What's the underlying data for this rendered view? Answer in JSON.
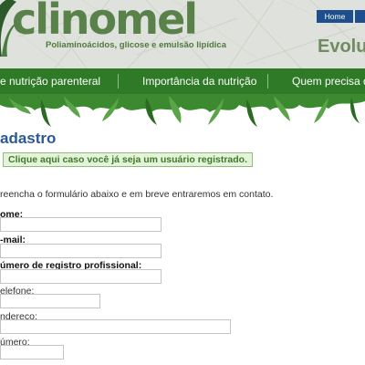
{
  "header": {
    "logo_text": "clinomel",
    "tagline": "Poliaminoácidos, glicose e emulsão lipídica",
    "slogan": "Evoluçã",
    "links": [
      "Home",
      ""
    ]
  },
  "nav": {
    "items": [
      "e nutrição parenteral",
      "Importância da nutrição",
      "Quem precisa d"
    ]
  },
  "content": {
    "title": "adastro",
    "notice": "Clique aqui caso você já seja um usuário registrado.",
    "intro": "reencha o formulário abaixo e em breve entraremos em contato.",
    "fields": [
      {
        "label": "ome:",
        "bold": true,
        "value": ""
      },
      {
        "label": "-mail:",
        "bold": true,
        "value": ""
      },
      {
        "label": "úmero de registro profissional:",
        "bold": true,
        "value": ""
      },
      {
        "label": "elefone:",
        "bold": false,
        "value": ""
      },
      {
        "label": "ndereço:",
        "bold": false,
        "value": ""
      },
      {
        "label": "úmero:",
        "bold": false,
        "value": ""
      }
    ]
  },
  "colors": {
    "brand_green": "#2e7a27",
    "title_blue": "#2b5a93",
    "link_blue": "#1d4f8c"
  }
}
